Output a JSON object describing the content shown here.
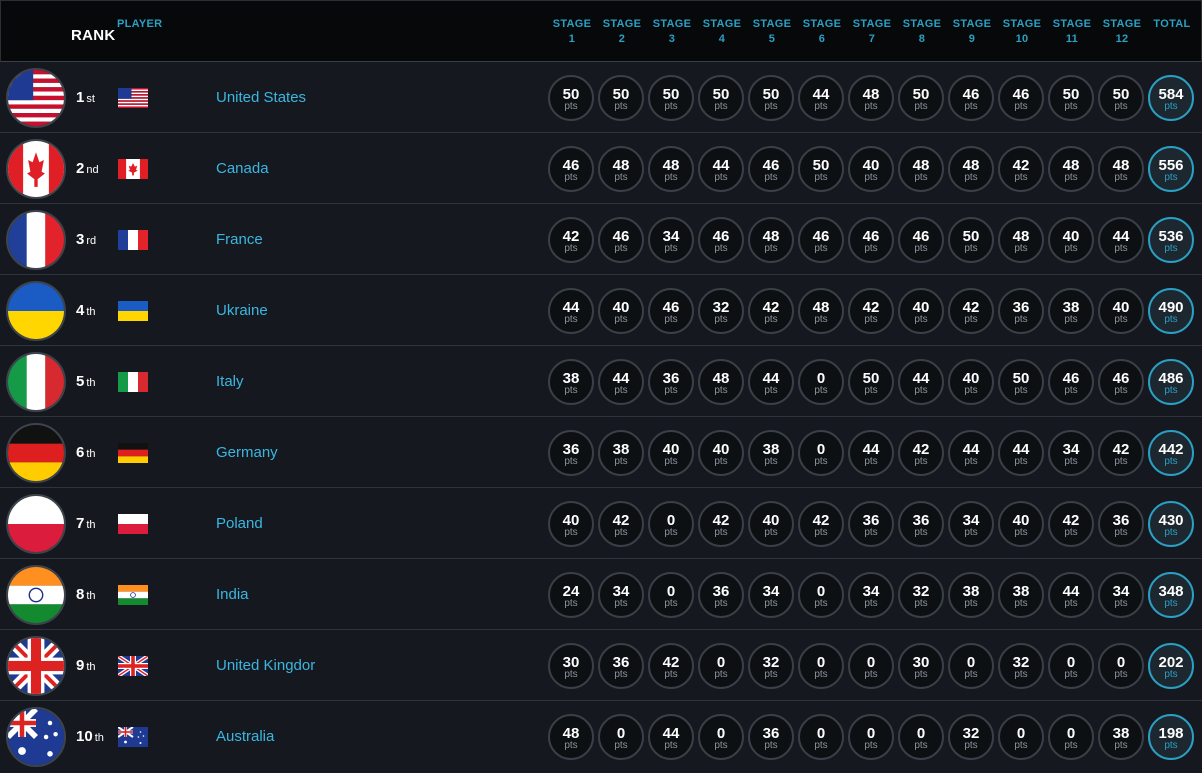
{
  "header": {
    "rank_label": "RANK",
    "player_label": "PLAYER",
    "stage_label": "STAGE",
    "stages": [
      "1",
      "2",
      "3",
      "4",
      "5",
      "6",
      "7",
      "8",
      "9",
      "10",
      "11",
      "12"
    ],
    "total_label": "TOTAL"
  },
  "unit_label": "pts",
  "players": [
    {
      "rank": "1",
      "suffix": "st",
      "country": "United States",
      "flag": "us",
      "scores": [
        "50",
        "50",
        "50",
        "50",
        "50",
        "44",
        "48",
        "50",
        "46",
        "46",
        "50",
        "50"
      ],
      "total": "584"
    },
    {
      "rank": "2",
      "suffix": "nd",
      "country": "Canada",
      "flag": "ca",
      "scores": [
        "46",
        "48",
        "48",
        "44",
        "46",
        "50",
        "40",
        "48",
        "48",
        "42",
        "48",
        "48"
      ],
      "total": "556"
    },
    {
      "rank": "3",
      "suffix": "rd",
      "country": "France",
      "flag": "fr",
      "scores": [
        "42",
        "46",
        "34",
        "46",
        "48",
        "46",
        "46",
        "46",
        "50",
        "48",
        "40",
        "44"
      ],
      "total": "536"
    },
    {
      "rank": "4",
      "suffix": "th",
      "country": "Ukraine",
      "flag": "ua",
      "scores": [
        "44",
        "40",
        "46",
        "32",
        "42",
        "48",
        "42",
        "40",
        "42",
        "36",
        "38",
        "40"
      ],
      "total": "490"
    },
    {
      "rank": "5",
      "suffix": "th",
      "country": "Italy",
      "flag": "it",
      "scores": [
        "38",
        "44",
        "36",
        "48",
        "44",
        "0",
        "50",
        "44",
        "40",
        "50",
        "46",
        "46"
      ],
      "total": "486"
    },
    {
      "rank": "6",
      "suffix": "th",
      "country": "Germany",
      "flag": "de",
      "scores": [
        "36",
        "38",
        "40",
        "40",
        "38",
        "0",
        "44",
        "42",
        "44",
        "44",
        "34",
        "42"
      ],
      "total": "442"
    },
    {
      "rank": "7",
      "suffix": "th",
      "country": "Poland",
      "flag": "pl",
      "scores": [
        "40",
        "42",
        "0",
        "42",
        "40",
        "42",
        "36",
        "36",
        "34",
        "40",
        "42",
        "36"
      ],
      "total": "430"
    },
    {
      "rank": "8",
      "suffix": "th",
      "country": "India",
      "flag": "in",
      "scores": [
        "24",
        "34",
        "0",
        "36",
        "34",
        "0",
        "34",
        "32",
        "38",
        "38",
        "44",
        "34"
      ],
      "total": "348"
    },
    {
      "rank": "9",
      "suffix": "th",
      "country": "United Kingdor",
      "flag": "gb",
      "scores": [
        "30",
        "36",
        "42",
        "0",
        "32",
        "0",
        "0",
        "30",
        "0",
        "32",
        "0",
        "0"
      ],
      "total": "202"
    },
    {
      "rank": "10",
      "suffix": "th",
      "country": "Australia",
      "flag": "au",
      "scores": [
        "48",
        "0",
        "44",
        "0",
        "36",
        "0",
        "0",
        "0",
        "32",
        "0",
        "0",
        "38"
      ],
      "total": "198"
    }
  ]
}
